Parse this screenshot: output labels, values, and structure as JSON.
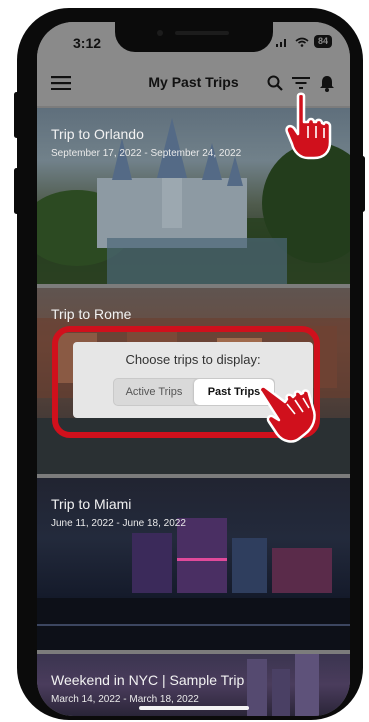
{
  "status": {
    "time": "3:12",
    "battery": "84"
  },
  "appbar": {
    "title": "My Past Trips"
  },
  "trips": [
    {
      "name": "Trip to Orlando",
      "dates": "September 17, 2022 - September 24, 2022"
    },
    {
      "name": "Trip to Rome",
      "dates": ""
    },
    {
      "name": "Trip to Miami",
      "dates": "June 11, 2022 - June 18, 2022"
    },
    {
      "name": "Weekend in NYC | Sample Trip",
      "dates": "March 14, 2022 - March 18, 2022"
    }
  ],
  "dialog": {
    "title": "Choose trips to display:",
    "options": [
      "Active Trips",
      "Past Trips"
    ],
    "selected": "Past Trips"
  },
  "icons": {
    "menu": "hamburger-menu-icon",
    "search": "search-icon",
    "filter": "filter-icon",
    "notifications": "bell-icon",
    "pointer": "pointing-hand-icon"
  },
  "colors": {
    "highlight": "#d0101c",
    "hand": "#d0101c"
  }
}
